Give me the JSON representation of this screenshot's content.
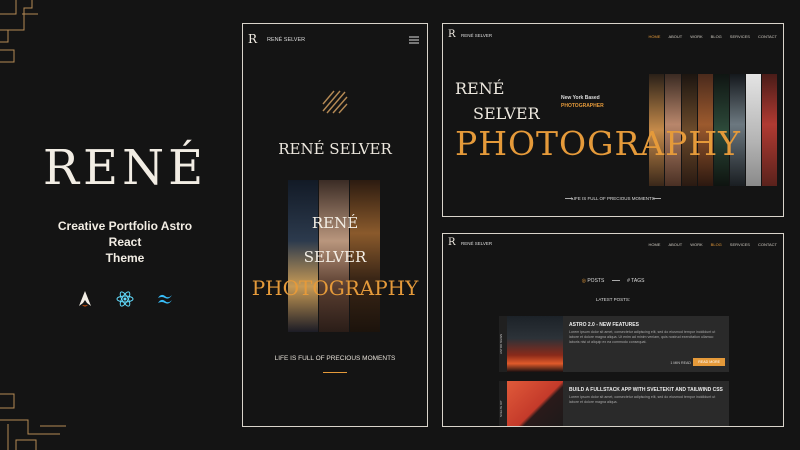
{
  "brand": {
    "title": "RENÉ",
    "subtitle_line1": "Creative Portfolio Astro React",
    "subtitle_line2": "Theme",
    "icons": [
      "astro-icon",
      "react-icon",
      "tailwind-icon"
    ]
  },
  "mobile": {
    "logo": "R",
    "site_name": "RENÉ SELVER",
    "hero_name": "RENÉ SELVER",
    "overlay_line1": "RENÉ",
    "overlay_line2": "SELVER",
    "overlay_line3": "PHOTOGRAPHY",
    "tagline": "LIFE IS FULL OF PRECIOUS MOMENTS"
  },
  "desktop_home": {
    "logo": "R",
    "site_name": "RENÉ SELVER",
    "nav": [
      "HOME",
      "ABOUT",
      "WORK",
      "BLOG",
      "SERVICES",
      "CONTACT"
    ],
    "active_nav": "HOME",
    "name_line1": "RENÉ",
    "name_line2": "SELVER",
    "location": "New York Based",
    "role": "PHOTOGRAPHER",
    "big_title": "PHOTOGRAPHY",
    "tagline": "LIFE IS FULL OF PRECIOUS MOMENTS"
  },
  "desktop_blog": {
    "logo": "R",
    "site_name": "RENÉ SELVER",
    "nav": [
      "HOME",
      "ABOUT",
      "WORK",
      "BLOG",
      "SERVICES",
      "CONTACT"
    ],
    "active_nav": "BLOG",
    "tab_posts": "POSTS",
    "tab_tags": "TAGS",
    "latest_label": "LATEST POSTS:",
    "posts": [
      {
        "title": "ASTRO 2.0 - NEW FEATURES",
        "body": "Lorem ipsum dolor sit amet, consectetur adipiscing elit, sed do eiusmod tempor incididunt ut labore et dolore magna aliqua. Ut enim ad minim veniam, quis nostrud exercitation ullamco laboris nisi ut aliquip ex ea commodo consequat.",
        "date": "1 MIN READ",
        "label": "READ MORE",
        "side": "ASTRO NEWS"
      },
      {
        "title": "BUILD A FULLSTACK APP WITH SVELTEKIT AND TAILWIND CSS",
        "body": "Lorem ipsum dolor sit amet, consectetur adipiscing elit, sed do eiusmod tempor incididunt ut labore et dolore magna aliqua.",
        "date": "",
        "label": "",
        "side": "SVELTE KIT"
      }
    ]
  },
  "colors": {
    "accent": "#e59a3a",
    "background": "#141414",
    "text": "#e8e3da"
  }
}
